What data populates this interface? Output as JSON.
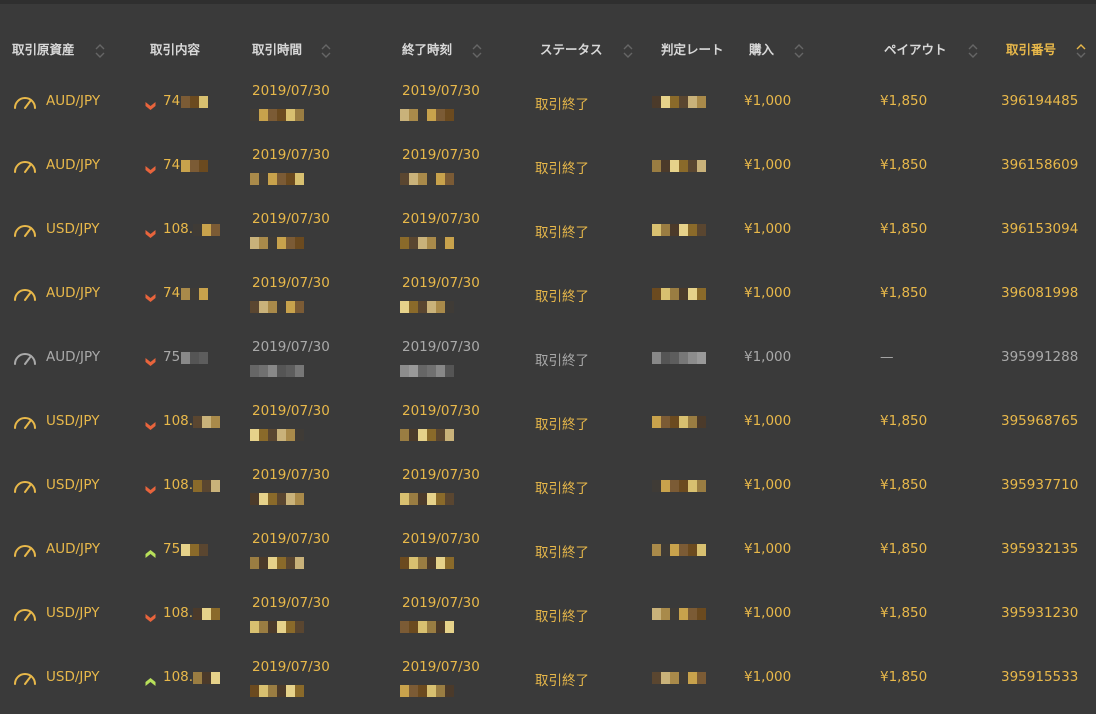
{
  "table": {
    "columns": {
      "asset": "取引原資産",
      "content": "取引内容",
      "time": "取引時間",
      "end_time": "終了時刻",
      "status": "ステータス",
      "judge_rate": "判定レート",
      "purchase": "購入",
      "payout": "ペイアウト",
      "trade_no": "取引番号"
    },
    "active_sort_column": "trade_no",
    "rows": [
      {
        "asset": "AUD/JPY",
        "direction": "down",
        "rate": "74.",
        "time": "2019/07/30",
        "end_time": "2019/07/30",
        "status": "取引終了",
        "purchase": "¥1,000",
        "payout": "¥1,850",
        "trade_no": "396194485"
      },
      {
        "asset": "AUD/JPY",
        "direction": "down",
        "rate": "74.",
        "time": "2019/07/30",
        "end_time": "2019/07/30",
        "status": "取引終了",
        "purchase": "¥1,000",
        "payout": "¥1,850",
        "trade_no": "396158609"
      },
      {
        "asset": "USD/JPY",
        "direction": "down",
        "rate": "108.",
        "time": "2019/07/30",
        "end_time": "2019/07/30",
        "status": "取引終了",
        "purchase": "¥1,000",
        "payout": "¥1,850",
        "trade_no": "396153094"
      },
      {
        "asset": "AUD/JPY",
        "direction": "down",
        "rate": "74.",
        "time": "2019/07/30",
        "end_time": "2019/07/30",
        "status": "取引終了",
        "purchase": "¥1,000",
        "payout": "¥1,850",
        "trade_no": "396081998"
      },
      {
        "asset": "AUD/JPY",
        "direction": "down",
        "rate": "75.",
        "time": "2019/07/30",
        "end_time": "2019/07/30",
        "status": "取引終了",
        "purchase": "¥1,000",
        "payout": "—",
        "trade_no": "395991288",
        "dim": true
      },
      {
        "asset": "USD/JPY",
        "direction": "down",
        "rate": "108.",
        "time": "2019/07/30",
        "end_time": "2019/07/30",
        "status": "取引終了",
        "purchase": "¥1,000",
        "payout": "¥1,850",
        "trade_no": "395968765"
      },
      {
        "asset": "USD/JPY",
        "direction": "down",
        "rate": "108.",
        "time": "2019/07/30",
        "end_time": "2019/07/30",
        "status": "取引終了",
        "purchase": "¥1,000",
        "payout": "¥1,850",
        "trade_no": "395937710"
      },
      {
        "asset": "AUD/JPY",
        "direction": "up",
        "rate": "75.",
        "time": "2019/07/30",
        "end_time": "2019/07/30",
        "status": "取引終了",
        "purchase": "¥1,000",
        "payout": "¥1,850",
        "trade_no": "395932135"
      },
      {
        "asset": "USD/JPY",
        "direction": "down",
        "rate": "108.",
        "time": "2019/07/30",
        "end_time": "2019/07/30",
        "status": "取引終了",
        "purchase": "¥1,000",
        "payout": "¥1,850",
        "trade_no": "395931230"
      },
      {
        "asset": "USD/JPY",
        "direction": "up",
        "rate": "108.",
        "time": "2019/07/30",
        "end_time": "2019/07/30",
        "status": "取引終了",
        "purchase": "¥1,000",
        "payout": "¥1,850",
        "trade_no": "395915533"
      }
    ]
  },
  "colors": {
    "background": "#3a3a3a",
    "accent": "#e8b84a",
    "header_text": "#d8d8d8",
    "muted_text": "#a9a9a9",
    "down_arrow": "#e8643c",
    "up_arrow": "#b8e05a"
  },
  "icons": {
    "asset": "gauge-icon",
    "down": "arrow-down-icon",
    "up": "arrow-up-icon",
    "sort": "sort-toggle-icon"
  }
}
